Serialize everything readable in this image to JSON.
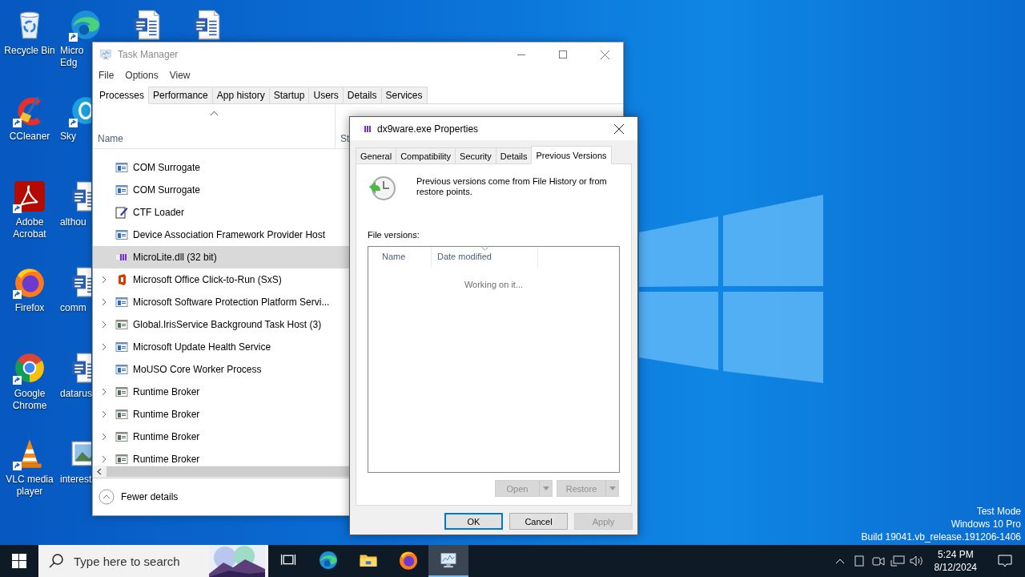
{
  "desktop": {
    "icon_columns": [
      [
        {
          "kind": "recycle-bin",
          "lines": [
            "Recycle Bin"
          ],
          "shortcut": false
        },
        {
          "kind": "ccleaner",
          "lines": [
            "CCleaner"
          ],
          "shortcut": true
        },
        {
          "kind": "acrobat",
          "lines": [
            "Adobe",
            "Acrobat"
          ],
          "shortcut": true
        },
        {
          "kind": "firefox",
          "lines": [
            "Firefox"
          ],
          "shortcut": true
        },
        {
          "kind": "chrome",
          "lines": [
            "Google",
            "Chrome"
          ],
          "shortcut": true
        },
        {
          "kind": "vlc",
          "lines": [
            "VLC media",
            "player"
          ],
          "shortcut": true
        }
      ],
      [
        {
          "kind": "edge",
          "lines": [
            "Micro",
            "Edg"
          ],
          "shortcut": true
        },
        {
          "kind": "skype",
          "lines": [
            "Sky"
          ],
          "shortcut": true
        },
        {
          "kind": "word",
          "lines": [
            "althou"
          ],
          "shortcut": false
        },
        {
          "kind": "word",
          "lines": [
            "comm"
          ],
          "shortcut": false
        },
        {
          "kind": "word",
          "lines": [
            "datarus"
          ],
          "shortcut": false
        },
        {
          "kind": "image-file",
          "lines": [
            "interest"
          ],
          "shortcut": false
        }
      ],
      [
        {
          "kind": "word",
          "shortcut": false
        }
      ],
      [
        {
          "kind": "word",
          "shortcut": false
        }
      ]
    ],
    "system_info": [
      "Test Mode",
      "Windows 10 Pro",
      "Build 19041.vb_release.191206-1406"
    ]
  },
  "task_manager": {
    "title": "Task Manager",
    "menu": [
      "File",
      "Options",
      "View"
    ],
    "tabs": [
      {
        "label": "Processes",
        "selected": true
      },
      {
        "label": "Performance",
        "selected": false
      },
      {
        "label": "App history",
        "selected": false
      },
      {
        "label": "Startup",
        "selected": false
      },
      {
        "label": "Users",
        "selected": false
      },
      {
        "label": "Details",
        "selected": false
      },
      {
        "label": "Services",
        "selected": false
      }
    ],
    "columns": [
      {
        "label": "Name",
        "sorted": true
      },
      {
        "label": "St",
        "sorted": false
      }
    ],
    "processes": [
      {
        "name": "COM Surrogate",
        "kind": "frame",
        "expandable": false,
        "selected": false
      },
      {
        "name": "COM Surrogate",
        "kind": "frame",
        "expandable": false,
        "selected": false
      },
      {
        "name": "CTF Loader",
        "kind": "pen",
        "expandable": false,
        "selected": false
      },
      {
        "name": "Device Association Framework Provider Host",
        "kind": "frame",
        "expandable": false,
        "selected": false
      },
      {
        "name": "MicroLite.dll (32 bit)",
        "kind": "purple",
        "expandable": false,
        "selected": true
      },
      {
        "name": "Microsoft Office Click-to-Run (SxS)",
        "kind": "office",
        "expandable": true,
        "selected": false
      },
      {
        "name": "Microsoft Software Protection Platform Servi...",
        "kind": "frame",
        "expandable": true,
        "selected": false
      },
      {
        "name": "Global.IrisService Background Task Host (3)",
        "kind": "frame-grey",
        "expandable": true,
        "selected": false
      },
      {
        "name": "Microsoft Update Health Service",
        "kind": "frame",
        "expandable": true,
        "selected": false
      },
      {
        "name": "MoUSO Core Worker Process",
        "kind": "frame",
        "expandable": false,
        "selected": false
      },
      {
        "name": "Runtime Broker",
        "kind": "frame-grey",
        "expandable": true,
        "selected": false
      },
      {
        "name": "Runtime Broker",
        "kind": "frame-grey",
        "expandable": true,
        "selected": false
      },
      {
        "name": "Runtime Broker",
        "kind": "frame-grey",
        "expandable": true,
        "selected": false
      },
      {
        "name": "Runtime Broker",
        "kind": "frame-grey",
        "expandable": true,
        "selected": false
      }
    ],
    "footer": "Fewer details"
  },
  "properties_dialog": {
    "title": "dx9ware.exe Properties",
    "tabs": [
      {
        "label": "General",
        "selected": false
      },
      {
        "label": "Compatibility",
        "selected": false
      },
      {
        "label": "Security",
        "selected": false
      },
      {
        "label": "Details",
        "selected": false
      },
      {
        "label": "Previous Versions",
        "selected": true
      }
    ],
    "description": "Previous versions come from File History or from restore points.",
    "list_label": "File versions:",
    "columns": [
      {
        "label": "Name",
        "sorted": false
      },
      {
        "label": "Date modified",
        "sorted": true
      }
    ],
    "status": "Working on it...",
    "actions": [
      {
        "label": "Open",
        "disabled": true
      },
      {
        "label": "Restore",
        "disabled": true
      }
    ],
    "buttons": [
      {
        "label": "OK",
        "default": true,
        "disabled": false
      },
      {
        "label": "Cancel",
        "default": false,
        "disabled": false
      },
      {
        "label": "Apply",
        "default": false,
        "disabled": true
      }
    ]
  },
  "taskbar": {
    "search": {
      "placeholder": "Type here to search"
    },
    "apps": [
      {
        "kind": "task-view",
        "active": false
      },
      {
        "kind": "edge",
        "active": false
      },
      {
        "kind": "explorer",
        "active": false
      },
      {
        "kind": "firefox",
        "active": false
      },
      {
        "kind": "task-manager",
        "active": true
      }
    ],
    "tray": {
      "time": "5:24 PM",
      "date": "8/12/2024"
    }
  }
}
